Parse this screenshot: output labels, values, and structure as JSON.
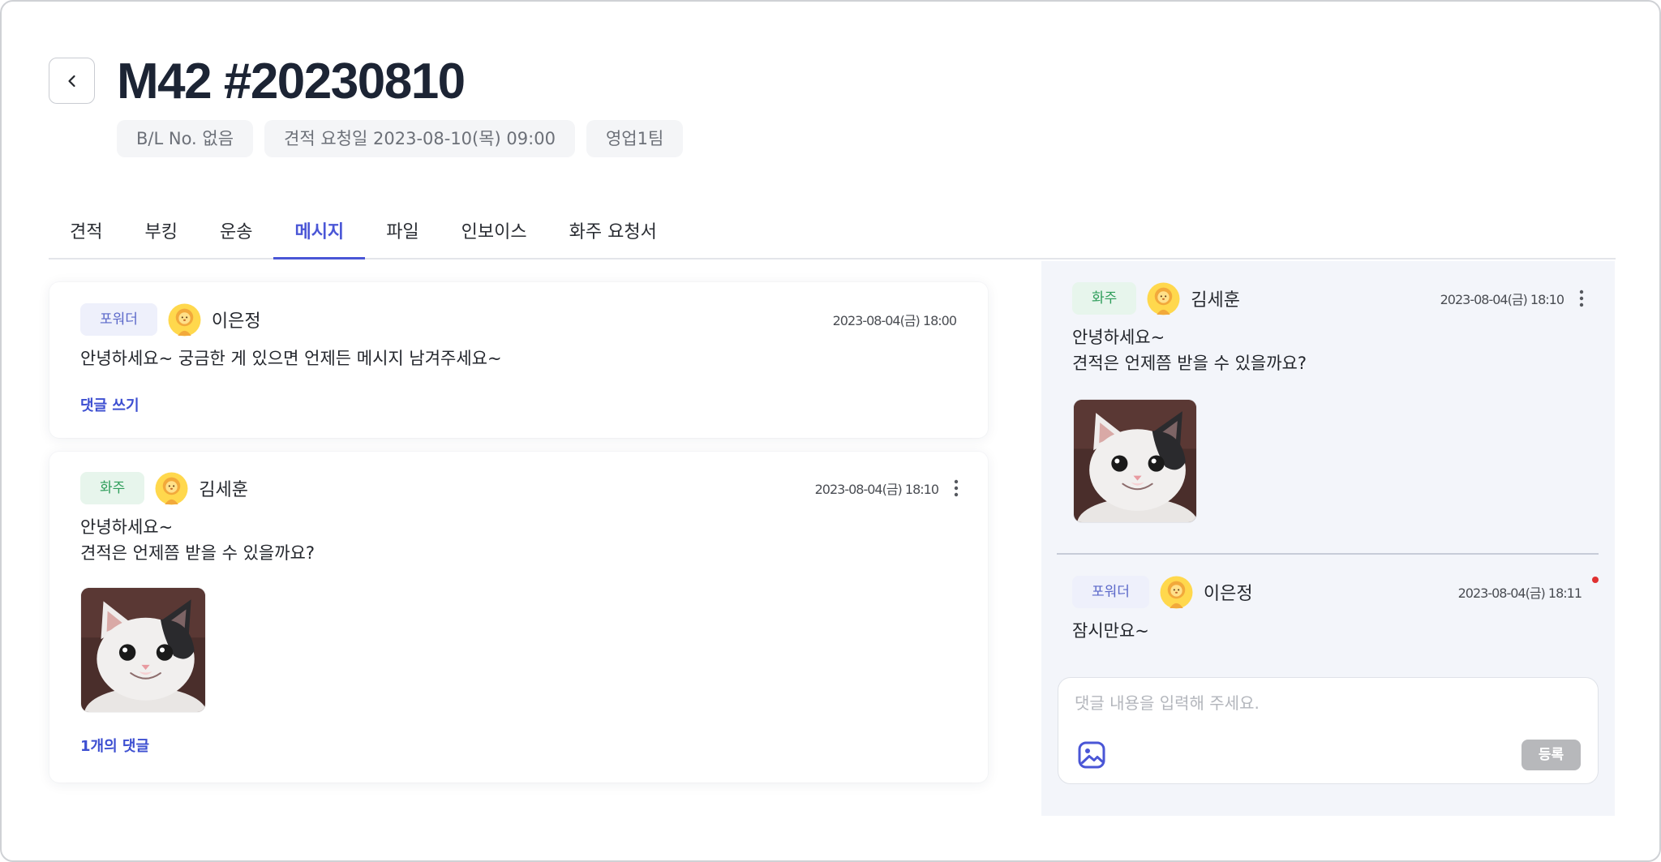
{
  "header": {
    "back_icon": "chevron-left-icon",
    "title": "M42 #20230810",
    "chips": [
      {
        "label": "B/L No. 없음"
      },
      {
        "label": "견적 요청일 2023-08-10(목) 09:00"
      },
      {
        "label": "영업1팀"
      }
    ]
  },
  "tabs": [
    {
      "label": "견적",
      "active": false
    },
    {
      "label": "부킹",
      "active": false
    },
    {
      "label": "운송",
      "active": false
    },
    {
      "label": "메시지",
      "active": true
    },
    {
      "label": "파일",
      "active": false
    },
    {
      "label": "인보이스",
      "active": false
    },
    {
      "label": "화주 요청서",
      "active": false
    }
  ],
  "messages": [
    {
      "role": "포워더",
      "avatar_icon": "lion-avatar-icon",
      "author": "이은정",
      "time": "2023-08-04(금) 18:00",
      "lines": [
        "안녕하세요~ 궁금한 게 있으면 언제든 메시지 남겨주세요~"
      ],
      "has_image_attachment": false,
      "has_menu": false,
      "action_label": "댓글 쓰기"
    },
    {
      "role": "화주",
      "avatar_icon": "lion-avatar-icon",
      "author": "김세훈",
      "time": "2023-08-04(금) 18:10",
      "lines": [
        "안녕하세요~",
        "견적은 언제쯤 받을 수 있을까요?"
      ],
      "has_image_attachment": true,
      "has_menu": true,
      "menu_icon": "more-vertical-icon",
      "action_label": "1개의 댓글"
    }
  ],
  "thread": {
    "parent": {
      "role": "화주",
      "avatar_icon": "lion-avatar-icon",
      "author": "김세훈",
      "time": "2023-08-04(금) 18:10",
      "lines": [
        "안녕하세요~",
        "견적은 언제쯤 받을 수 있을까요?"
      ],
      "has_image_attachment": true,
      "has_menu": true,
      "menu_icon": "more-vertical-icon"
    },
    "replies": [
      {
        "role": "포워더",
        "avatar_icon": "lion-avatar-icon",
        "author": "이은정",
        "time": "2023-08-04(금) 18:11",
        "lines": [
          "잠시만요~"
        ],
        "unread": true
      }
    ],
    "composer": {
      "placeholder": "댓글 내용을 입력해 주세요.",
      "attach_icon": "image-icon",
      "submit_label": "등록"
    }
  },
  "colors": {
    "accent": "#4a56d6",
    "link": "#3d4fd1",
    "title": "#1c2434",
    "forwarder_badge_bg": "#eef0fb",
    "forwarder_badge_text": "#5b68c9",
    "shipper_badge_bg": "#e7f5ec",
    "shipper_badge_text": "#2e9d5a",
    "thread_bg": "#f3f5fa",
    "unread_dot": "#e03131",
    "submit_disabled": "#b7b8bb"
  }
}
